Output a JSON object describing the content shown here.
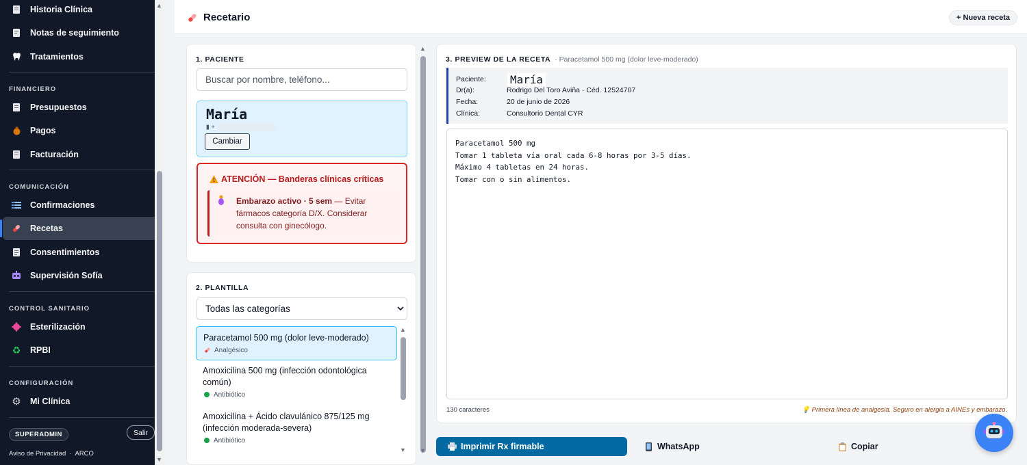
{
  "sidebar": {
    "items_top": [
      {
        "label": "Historia Clínica",
        "icon": "clipboard-icon"
      },
      {
        "label": "Notas de seguimiento",
        "icon": "notes-icon"
      },
      {
        "label": "Tratamientos",
        "icon": "tooth-icon"
      }
    ],
    "sections": [
      {
        "title": "FINANCIERO",
        "items": [
          {
            "label": "Presupuestos",
            "icon": "document-icon"
          },
          {
            "label": "Pagos",
            "icon": "money-bag-icon"
          },
          {
            "label": "Facturación",
            "icon": "invoice-icon"
          }
        ]
      },
      {
        "title": "COMUNICACIÓN",
        "items": [
          {
            "label": "Confirmaciones",
            "icon": "list-icon"
          },
          {
            "label": "Recetas",
            "icon": "pill-icon",
            "active": true
          },
          {
            "label": "Consentimientos",
            "icon": "form-icon"
          },
          {
            "label": "Supervisión Sofía",
            "icon": "robot-icon"
          }
        ]
      },
      {
        "title": "CONTROL SANITARIO",
        "items": [
          {
            "label": "Esterilización",
            "icon": "germ-icon"
          },
          {
            "label": "RPBI",
            "icon": "recycle-icon"
          }
        ]
      },
      {
        "title": "CONFIGURACIÓN",
        "items": [
          {
            "label": "Mi Clínica",
            "icon": "gear-icon"
          }
        ]
      }
    ],
    "role_badge": "SUPERADMIN",
    "logout_label": "Salir",
    "footer": {
      "privacy": "Aviso de Privacidad",
      "sep": "·",
      "arco": "ARCO"
    }
  },
  "header": {
    "title": "Recetario",
    "new_button": "+ Nueva receta"
  },
  "patient": {
    "section_title": "1. PACIENTE",
    "search_placeholder": "Buscar por nombre, teléfono...",
    "name": "María",
    "phone_prefix": "+",
    "change_button": "Cambiar",
    "alert_title": "ATENCIÓN — Banderas clínicas críticas",
    "alert_bold": "Embarazo activo · 5 sem",
    "alert_text": " — Evitar fármacos categoría D/X. Considerar consulta con ginecólogo."
  },
  "template": {
    "section_title": "2. PLANTILLA",
    "category_select": "Todas las categorías",
    "items": [
      {
        "name": "Paracetamol 500 mg (dolor leve-moderado)",
        "category": "Analgésico",
        "selected": true
      },
      {
        "name": "Amoxicilina 500 mg (infección odontológica común)",
        "category": "Antibiótico"
      },
      {
        "name": "Amoxicilina + Ácido clavulánico 875/125 mg (infección moderada-severa)",
        "category": "Antibiótico"
      }
    ]
  },
  "preview": {
    "section_title": "3. PREVIEW DE LA RECETA",
    "subtitle": "· Paracetamol 500 mg (dolor leve-moderado)",
    "labels": {
      "patient": "Paciente:",
      "doctor": "Dr(a):",
      "date": "Fecha:",
      "clinic": "Clínica:"
    },
    "patient": "María",
    "doctor": "Rodrigo Del Toro Aviña · Céd. 12524707",
    "date": "20 de junio de 2026",
    "clinic": "Consultorio Dental CYR",
    "body": "Paracetamol 500 mg\nTomar 1 tableta vía oral cada 6-8 horas por 3-5 días.\nMáximo 4 tabletas en 24 horas.\nTomar con o sin alimentos.",
    "char_count": "130 caracteres",
    "hint": "Primera línea de analgesia. Seguro en alergia a AINEs y embarazo."
  },
  "actions": {
    "print": "Imprimir Rx firmable",
    "whatsapp": "WhatsApp",
    "copy": "Copiar"
  },
  "colors": {
    "accent": "#0369a1",
    "sidebar_bg": "#111827",
    "alert": "#dc2626",
    "selected_bg": "#e0f2fe"
  }
}
